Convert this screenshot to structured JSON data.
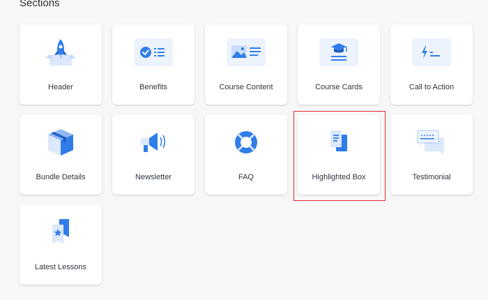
{
  "section": {
    "title": "Sections"
  },
  "cards": [
    {
      "label": "Header",
      "icon": "rocket-icon"
    },
    {
      "label": "Benefits",
      "icon": "benefits-list-icon"
    },
    {
      "label": "Course Content",
      "icon": "image-content-icon"
    },
    {
      "label": "Course Cards",
      "icon": "graduation-cap-card-icon"
    },
    {
      "label": "Call to Action",
      "icon": "lightning-cta-icon"
    },
    {
      "label": "Bundle Details",
      "icon": "box-bundle-icon"
    },
    {
      "label": "Newsletter",
      "icon": "megaphone-icon"
    },
    {
      "label": "FAQ",
      "icon": "lifebuoy-icon"
    },
    {
      "label": "Highlighted Box",
      "icon": "documents-icon"
    },
    {
      "label": "Testimonial",
      "icon": "chat-bubbles-icon"
    },
    {
      "label": "Latest Lessons",
      "icon": "bookmark-star-icon"
    }
  ],
  "colors": {
    "primary_blue": "#2f7de9",
    "light_blue": "#dce8fb",
    "pale_blue": "#edf3fd",
    "highlight_red": "#e0282e"
  }
}
